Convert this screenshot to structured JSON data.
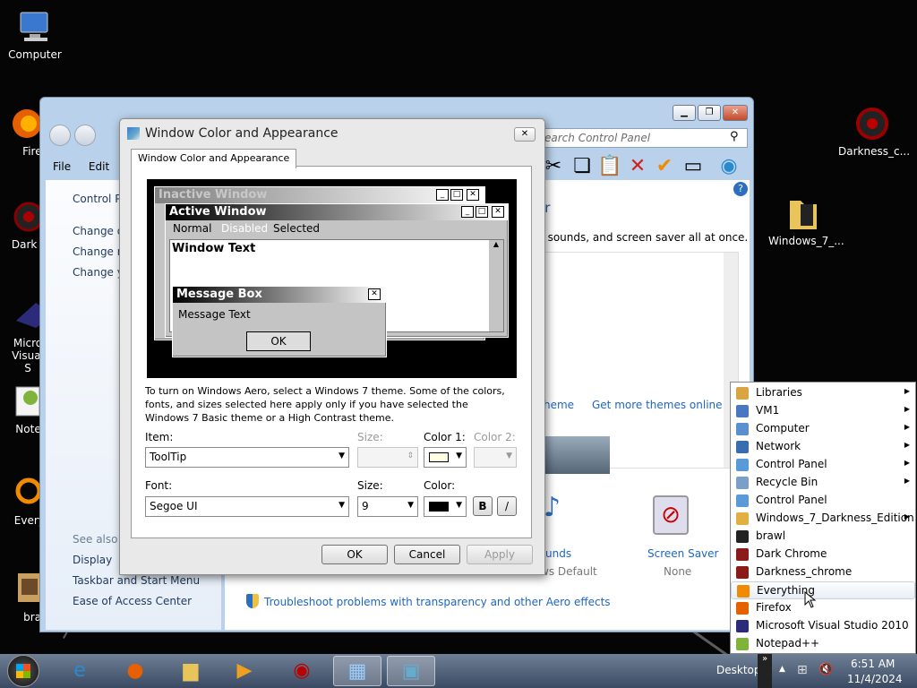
{
  "desktop_icons": [
    {
      "label": "Computer",
      "icon": "computer-icon"
    },
    {
      "label": "Firef",
      "icon": "firefox-icon"
    },
    {
      "label": "Dark Ch",
      "icon": "dark-chrome-icon"
    },
    {
      "label": "Micro Visual S",
      "icon": "visual-studio-icon"
    },
    {
      "label": "Notepa",
      "icon": "notepad-icon"
    },
    {
      "label": "Everyth",
      "icon": "everything-icon"
    },
    {
      "label": "braw",
      "icon": "brawl-icon"
    },
    {
      "label": "Darkness_c...",
      "icon": "darkness-chrome-icon"
    },
    {
      "label": "Windows_7_...",
      "icon": "folder-icon"
    }
  ],
  "control_panel": {
    "menu": [
      "File",
      "Edit"
    ],
    "search_placeholder": "earch Control Panel",
    "left_links": [
      "Control Pa",
      "Change d",
      "Change m",
      "Change yo"
    ],
    "see_also_title": "See also",
    "see_also": [
      "Display",
      "Taskbar and Start Menu",
      "Ease of Access Center"
    ],
    "heading_frag": "er",
    "desc_frag": "r, sounds, and screen saver all at once.",
    "theme_link_frag": "heme",
    "more_themes_link": "Get more themes online",
    "sounds_label": "unds",
    "sounds_value": "ws Default",
    "screensaver_label": "Screen Saver",
    "screensaver_value": "None",
    "troubleshoot_link": "Troubleshoot problems with transparency and other Aero effects"
  },
  "dialog": {
    "title": "Window Color and Appearance",
    "tab": "Window Color and Appearance",
    "preview": {
      "inactive_title": "Inactive Window",
      "active_title": "Active Window",
      "menu": [
        "Normal",
        "Disabled",
        "Selected"
      ],
      "window_text": "Window Text",
      "msgbox_title": "Message Box",
      "msgbox_text": "Message Text",
      "ok": "OK"
    },
    "info_text": "To turn on Windows Aero, select a Windows 7 theme.  Some of the colors, fonts, and sizes selected here apply only if you have selected the Windows 7 Basic theme or a High Contrast theme.",
    "item_label": "Item:",
    "item_value": "ToolTip",
    "size_label": "Size:",
    "color1_label": "Color 1:",
    "color2_label": "Color 2:",
    "font_label": "Font:",
    "font_value": "Segoe UI",
    "font_size_label": "Size:",
    "font_size_value": "9",
    "color_label": "Color:",
    "bold": "B",
    "italic": "/",
    "ok": "OK",
    "cancel": "Cancel",
    "apply": "Apply"
  },
  "flyout": {
    "items": [
      {
        "label": "Libraries",
        "sub": true,
        "color": "#d9a441"
      },
      {
        "label": "VM1",
        "sub": true,
        "color": "#4a78c0"
      },
      {
        "label": "Computer",
        "sub": true,
        "color": "#5a8fd0"
      },
      {
        "label": "Network",
        "sub": true,
        "color": "#3a6db0"
      },
      {
        "label": "Control Panel",
        "sub": true,
        "color": "#5a9ad8"
      },
      {
        "label": "Recycle Bin",
        "sub": true,
        "color": "#7aa0c8"
      },
      {
        "label": "Control Panel",
        "sub": false,
        "color": "#5a9ad8"
      },
      {
        "label": "Windows_7_Darkness_Edition",
        "sub": true,
        "color": "#e0b040"
      },
      {
        "label": "brawl",
        "sub": false,
        "color": "#222222"
      },
      {
        "label": "Dark Chrome",
        "sub": false,
        "color": "#8b1a1a"
      },
      {
        "label": "Darkness_chrome",
        "sub": false,
        "color": "#8b1a1a"
      },
      {
        "label": "Everything",
        "sub": false,
        "color": "#f08a00"
      },
      {
        "label": "Firefox",
        "sub": false,
        "color": "#e66000"
      },
      {
        "label": "Microsoft Visual Studio 2010",
        "sub": false,
        "color": "#2b2b7a"
      },
      {
        "label": "Notepad++",
        "sub": false,
        "color": "#7fb33b"
      }
    ]
  },
  "taskbar": {
    "desktop_label": "Desktop",
    "time": "6:51 AM",
    "date": "11/4/2024"
  }
}
